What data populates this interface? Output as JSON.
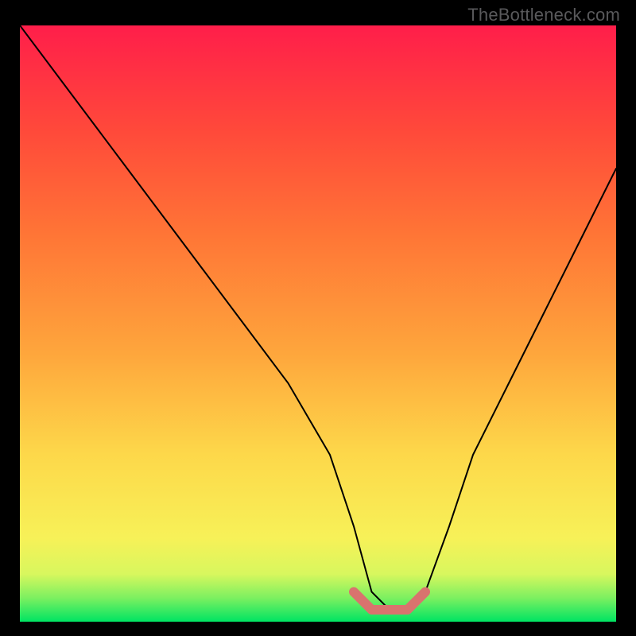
{
  "attribution": "TheBottleneck.com",
  "chart_data": {
    "type": "line",
    "title": "",
    "xlabel": "",
    "ylabel": "",
    "xlim": [
      0,
      100
    ],
    "ylim": [
      0,
      100
    ],
    "series": [
      {
        "name": "curve",
        "x": [
          0,
          9,
          18,
          27,
          36,
          45,
          52,
          56,
          59,
          62,
          65,
          68,
          72,
          76,
          82,
          88,
          94,
          100
        ],
        "values": [
          100,
          88,
          76,
          64,
          52,
          40,
          28,
          16,
          5,
          2,
          2,
          5,
          16,
          28,
          40,
          52,
          64,
          76
        ]
      }
    ],
    "highlight": {
      "name": "bottleneck-band",
      "x": [
        56,
        59,
        62,
        65,
        68
      ],
      "values": [
        5,
        2,
        2,
        2,
        5
      ]
    },
    "gradient_stops": [
      {
        "pct": 0,
        "color": "#00e463"
      },
      {
        "pct": 4,
        "color": "#7cf060"
      },
      {
        "pct": 8,
        "color": "#d8f75e"
      },
      {
        "pct": 14,
        "color": "#f7f158"
      },
      {
        "pct": 28,
        "color": "#fdd84a"
      },
      {
        "pct": 45,
        "color": "#fea63c"
      },
      {
        "pct": 65,
        "color": "#ff7536"
      },
      {
        "pct": 82,
        "color": "#ff4a3a"
      },
      {
        "pct": 100,
        "color": "#ff1e4a"
      }
    ]
  }
}
